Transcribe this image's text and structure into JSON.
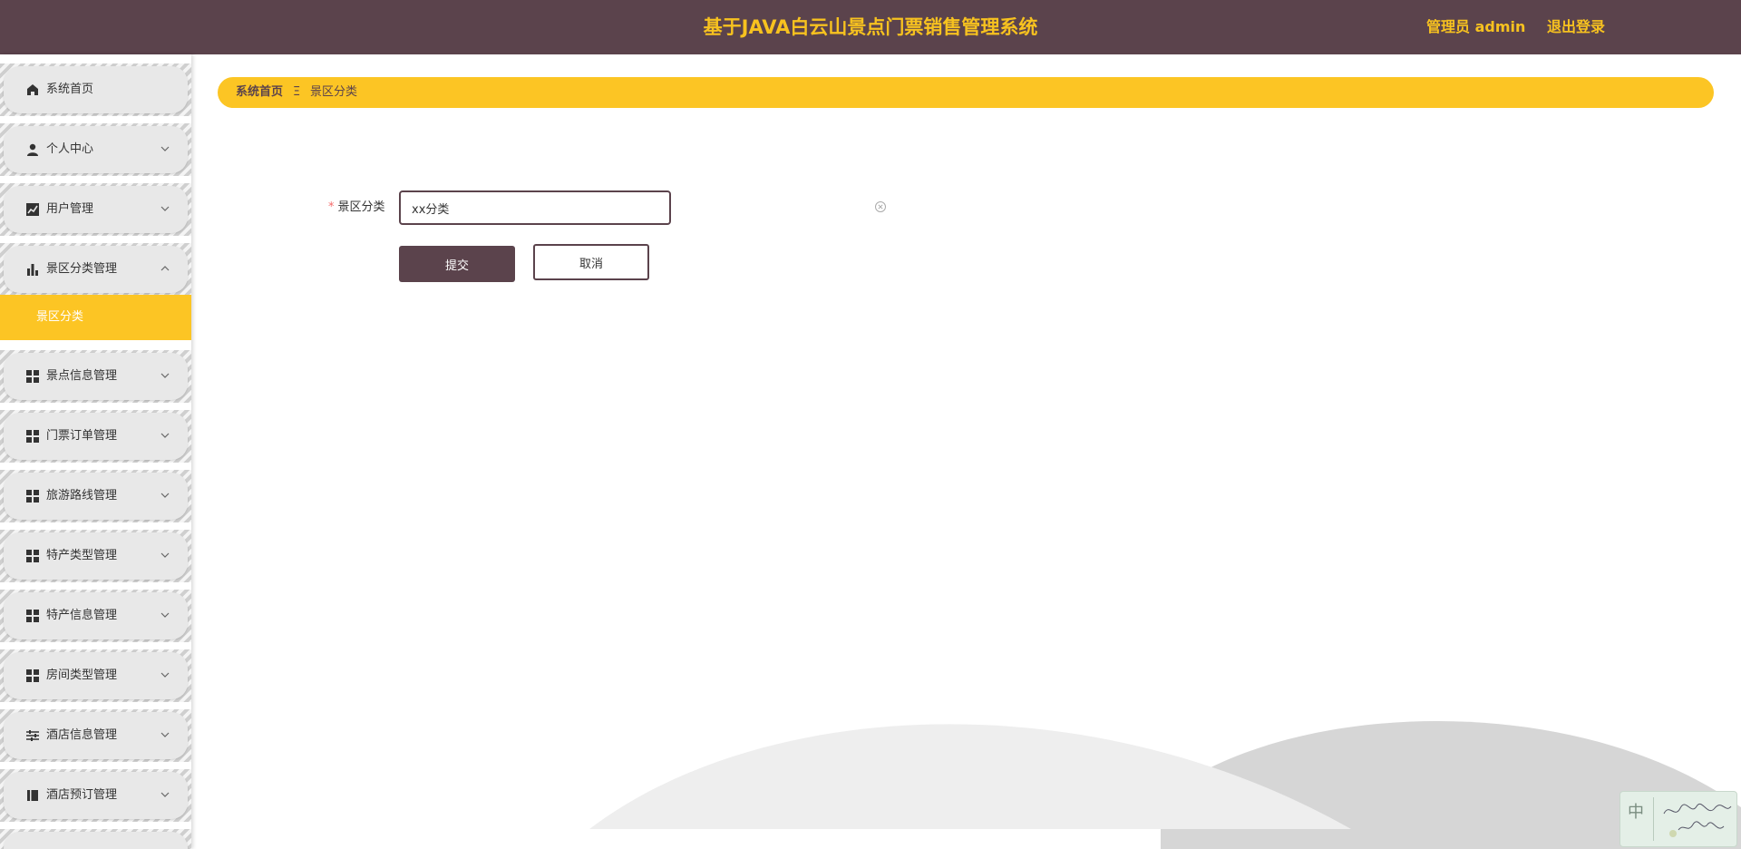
{
  "header": {
    "title": "基于JAVA白云山景点门票销售管理系统",
    "user": "管理员 admin",
    "logout": "退出登录"
  },
  "sidebar": {
    "items": [
      {
        "label": "系统首页",
        "icon": "home-icon",
        "chevron": false
      },
      {
        "label": "个人中心",
        "icon": "user-icon",
        "chevron": true
      },
      {
        "label": "用户管理",
        "icon": "chart-line-icon",
        "chevron": true
      },
      {
        "label": "景区分类管理",
        "icon": "bar-chart-icon",
        "chevron": true,
        "expanded": true
      },
      {
        "label": "景点信息管理",
        "icon": "grid-icon",
        "chevron": true
      },
      {
        "label": "门票订单管理",
        "icon": "grid-icon",
        "chevron": true
      },
      {
        "label": "旅游路线管理",
        "icon": "grid-icon",
        "chevron": true
      },
      {
        "label": "特产类型管理",
        "icon": "grid-icon",
        "chevron": true
      },
      {
        "label": "特产信息管理",
        "icon": "grid-icon",
        "chevron": true
      },
      {
        "label": "房间类型管理",
        "icon": "grid-icon",
        "chevron": true
      },
      {
        "label": "酒店信息管理",
        "icon": "sliders-icon",
        "chevron": true
      },
      {
        "label": "酒店预订管理",
        "icon": "book-icon",
        "chevron": true
      }
    ],
    "subitem": {
      "label": "景区分类"
    }
  },
  "breadcrumb": {
    "home": "系统首页",
    "separator": "Ξ",
    "current": "景区分类"
  },
  "form": {
    "required_mark": "*",
    "label": "景区分类",
    "value": "xx分类",
    "submit": "提交",
    "cancel": "取消"
  },
  "ime": {
    "mode": "中"
  },
  "colors": {
    "primary": "#5b434c",
    "accent": "#fcc524",
    "title": "#f7c21f"
  }
}
